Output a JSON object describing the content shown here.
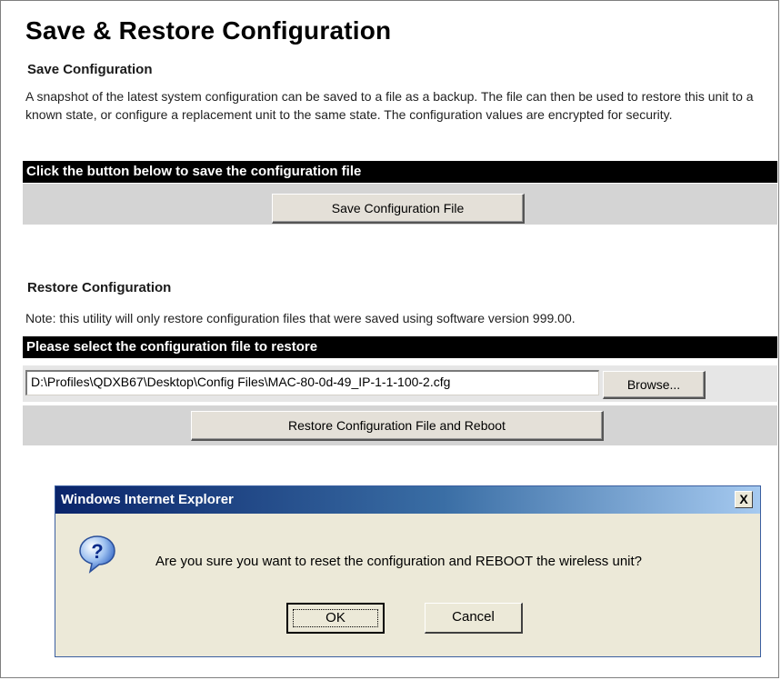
{
  "page": {
    "title": "Save & Restore Configuration"
  },
  "save_section": {
    "heading": "Save Configuration",
    "description": "A snapshot of the latest system configuration can be saved to a file as a backup. The file can then be used to restore this unit to a known state, or configure a replacement unit to the same state. The configuration values are encrypted for security.",
    "bar_label": "Click the button below to save the configuration file",
    "button_label": "Save Configuration File"
  },
  "restore_section": {
    "heading": "Restore Configuration",
    "note": "Note: this utility will only restore configuration files that were saved using software version 999.00.",
    "bar_label": "Please select the configuration file to restore",
    "file_path": "D:\\Profiles\\QDXB67\\Desktop\\Config Files\\MAC-80-0d-49_IP-1-1-100-2.cfg",
    "browse_label": "Browse...",
    "button_label": "Restore Configuration File and Reboot"
  },
  "dialog": {
    "title": "Windows Internet Explorer",
    "close_label": "X",
    "icon": "question-icon",
    "message": "Are you sure you want to reset the configuration and REBOOT the wireless unit?",
    "ok_label": "OK",
    "cancel_label": "Cancel"
  },
  "colors": {
    "bar_background": "#000000",
    "band_background": "#d4d4d4",
    "dialog_title_start": "#0a246a",
    "dialog_title_end": "#a6caf0",
    "dialog_body": "#ece9d8"
  }
}
